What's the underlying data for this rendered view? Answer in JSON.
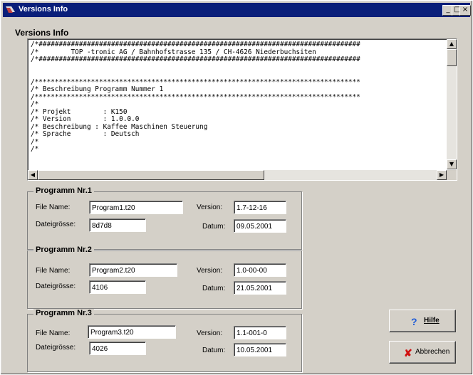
{
  "window": {
    "title": "Versions Info",
    "controls": [
      "_",
      "□",
      "×"
    ]
  },
  "heading": "Versions Info",
  "textarea": {
    "lines": [
      "/*################################################################################",
      "/*        TOP -tronic AG / Bahnhofstrasse 135 / CH-4626 Niederbuchsiten",
      "/*################################################################################",
      "",
      "",
      "/*********************************************************************************",
      "/* Beschreibung Programm Nummer 1",
      "/*********************************************************************************",
      "/*",
      "/* Projekt        : K150",
      "/* Version        : 1.0.0.0",
      "/* Beschreibung : Kaffee Maschinen Steuerung",
      "/* Sprache        : Deutsch",
      "/*",
      "/*"
    ]
  },
  "labels": {
    "file_name": "File Name:",
    "size": "Dateigrösse:",
    "version": "Version:",
    "date": "Datum:"
  },
  "programs": [
    {
      "title": "Programm Nr.1",
      "file": "Program1.t20",
      "size": "8d7d8",
      "version": "1.7-12-16",
      "date": "09.05.2001"
    },
    {
      "title": "Programm Nr.2",
      "file": "Program2.t20",
      "size": "4106",
      "version": "1.0-00-00",
      "date": "21.05.2001"
    },
    {
      "title": "Programm Nr.3",
      "file": "Program3.t20",
      "size": "4026",
      "version": "1.1-001-0",
      "date": "10.05.2001"
    }
  ],
  "buttons": {
    "help": {
      "icon": "?",
      "label": "Hilfe"
    },
    "cancel": {
      "icon": "✘",
      "label": "Abbrechen"
    }
  },
  "colors": {
    "titlebar": "#0a1f7a",
    "face": "#d4d0c8",
    "help_icon": "#1d5bd8",
    "cancel_icon": "#d01010"
  }
}
